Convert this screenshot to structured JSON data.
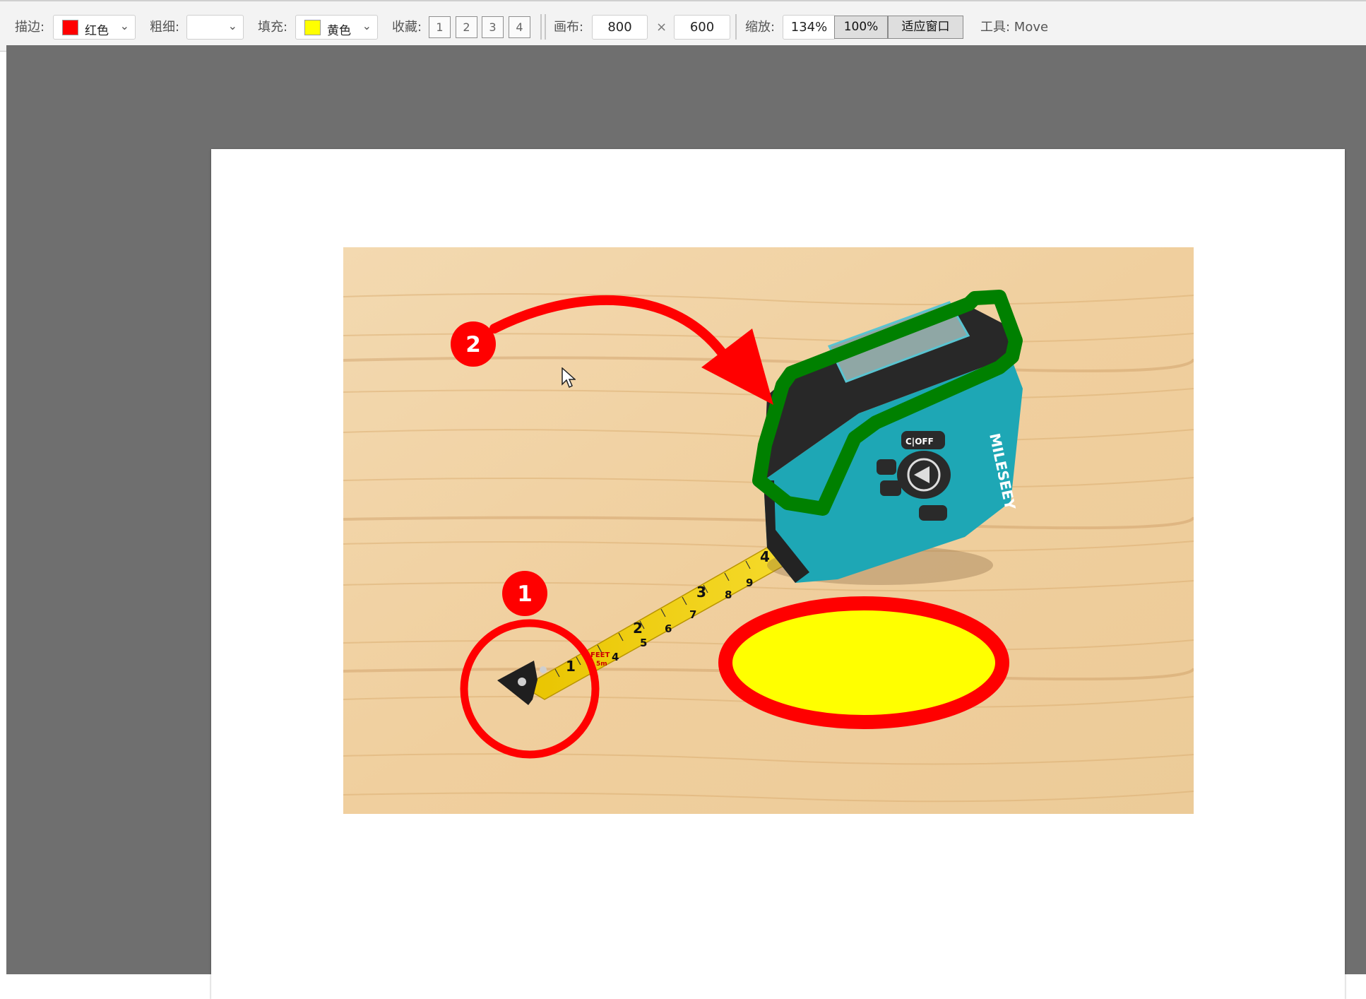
{
  "toolbar": {
    "stroke_label": "描边:",
    "stroke_value": "红色",
    "stroke_color": "#ff0000",
    "width_label": "粗细:",
    "width_value": "",
    "fill_label": "填充:",
    "fill_value": "黄色",
    "fill_color": "#ffff00",
    "favorites_label": "收藏:",
    "favorites": [
      "1",
      "2",
      "3",
      "4"
    ],
    "canvas_label": "画布:",
    "canvas_width": "800",
    "canvas_times": "×",
    "canvas_height": "600",
    "zoom_label": "缩放:",
    "zoom_value": "134%",
    "zoom_100_button": "100%",
    "fit_window_button": "适应窗口",
    "tool_status": "工具: Move"
  },
  "annotations": {
    "marker_1": "1",
    "marker_2": "2",
    "colors": {
      "arrow": "#ff0000",
      "circle": "#ff0000",
      "ellipse_stroke": "#ff0000",
      "ellipse_fill": "#ffff00",
      "outline": "#008000"
    }
  },
  "photo": {
    "device_brand": "MILESEEY",
    "button_c_off": "C|OFF",
    "tape_numbers": [
      "1",
      "2",
      "3",
      "4"
    ],
    "tape_small_numbers": [
      "4",
      "5",
      "6",
      "7",
      "8",
      "9"
    ],
    "tape_feet": "FEET",
    "tape_5m": "5m"
  }
}
